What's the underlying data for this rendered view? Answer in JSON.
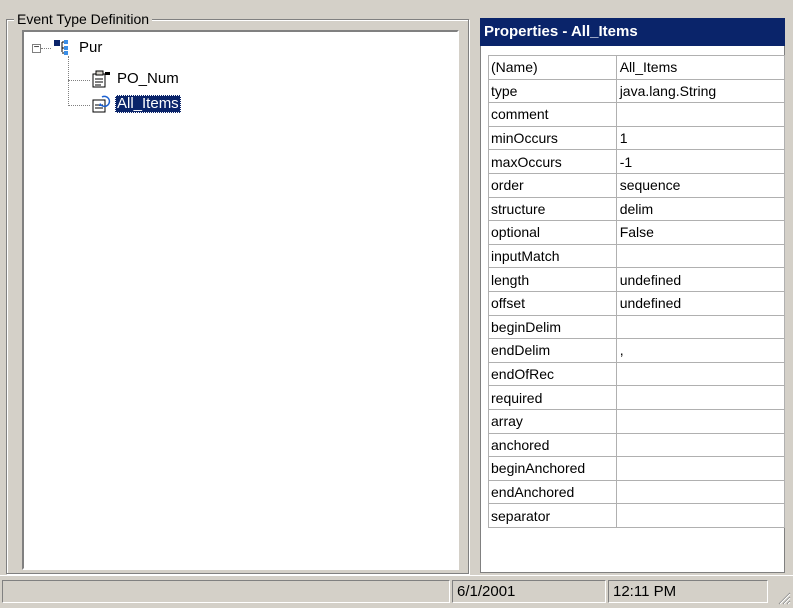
{
  "event_type_group": {
    "title": "Event Type Definition"
  },
  "tree": {
    "root": {
      "label": "Pur",
      "icon": "structure-icon",
      "expander": "−"
    },
    "children": [
      {
        "label": "PO_Num",
        "icon": "property-field-icon",
        "selected": false
      },
      {
        "label": "All_Items",
        "icon": "repeating-field-icon",
        "selected": true
      }
    ]
  },
  "properties": {
    "title": "Properties - All_Items",
    "rows": [
      {
        "key": "(Name)",
        "value": "All_Items"
      },
      {
        "key": "type",
        "value": "java.lang.String"
      },
      {
        "key": "comment",
        "value": ""
      },
      {
        "key": "minOccurs",
        "value": "1"
      },
      {
        "key": "maxOccurs",
        "value": "-1"
      },
      {
        "key": "order",
        "value": "sequence"
      },
      {
        "key": "structure",
        "value": "delim"
      },
      {
        "key": "optional",
        "value": "False"
      },
      {
        "key": "inputMatch",
        "value": ""
      },
      {
        "key": "length",
        "value": "undefined"
      },
      {
        "key": "offset",
        "value": "undefined"
      },
      {
        "key": "beginDelim",
        "value": ""
      },
      {
        "key": "endDelim",
        "value": ","
      },
      {
        "key": "endOfRec",
        "value": ""
      },
      {
        "key": "required",
        "value": ""
      },
      {
        "key": "array",
        "value": ""
      },
      {
        "key": "anchored",
        "value": ""
      },
      {
        "key": "beginAnchored",
        "value": ""
      },
      {
        "key": "endAnchored",
        "value": ""
      },
      {
        "key": "separator",
        "value": ""
      }
    ]
  },
  "statusbar": {
    "main": "",
    "date": "6/1/2001",
    "time": "12:11 PM"
  },
  "colors": {
    "window_bg": "#d4d0c8",
    "title_bg": "#0a246a",
    "selection_bg": "#0a246a"
  }
}
